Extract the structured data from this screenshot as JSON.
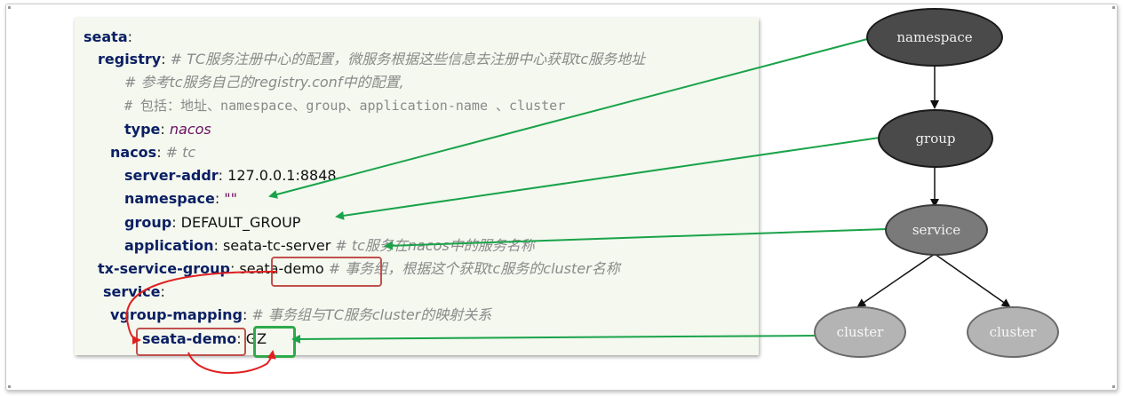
{
  "code": {
    "l1": {
      "key": "seata",
      "sep": ":"
    },
    "l2": {
      "key": "registry",
      "sep": ":",
      "comment": " # TC服务注册中心的配置，微服务根据这些信息去注册中心获取tc服务地址"
    },
    "l3": {
      "comment": "# 参考tc服务自己的registry.conf中的配置,"
    },
    "l4": {
      "comment": "# 包括：地址、namespace、group、application-name 、cluster"
    },
    "l5": {
      "key": "type",
      "sep": ":",
      "value": " nacos"
    },
    "l6": {
      "key": "nacos",
      "sep": ":",
      "comment": " # tc"
    },
    "l7": {
      "key": "server-addr",
      "sep": ":",
      "value": " 127.0.0.1:8848"
    },
    "l8": {
      "key": "namespace",
      "sep": ":",
      "value": " \"\""
    },
    "l9": {
      "key": "group",
      "sep": ":",
      "value": " DEFAULT_GROUP"
    },
    "l10": {
      "key": "application",
      "sep": ":",
      "value": " seata-tc-server",
      "comment": " # tc服务在nacos中的服务名称"
    },
    "l11": {
      "key": "tx-service-group",
      "sep": ":",
      "value": " seata-demo",
      "comment": " # 事务组，根据这个获取tc服务的cluster名称"
    },
    "l12": {
      "key": "service",
      "sep": ":"
    },
    "l13": {
      "key": "vgroup-mapping",
      "sep": ":",
      "comment": " # 事务组与TC服务cluster的映射关系"
    },
    "l14": {
      "key": "seata-demo",
      "sep": ":",
      "value": " GZ"
    }
  },
  "nodes": {
    "namespace": "namespace",
    "group": "group",
    "service": "service",
    "cluster1": "cluster",
    "cluster2": "cluster"
  },
  "colors": {
    "green_arrow": "#1aa34a",
    "red_arrow": "#e02020",
    "red_box": "#c0504d",
    "green_box": "#2faa4a"
  }
}
